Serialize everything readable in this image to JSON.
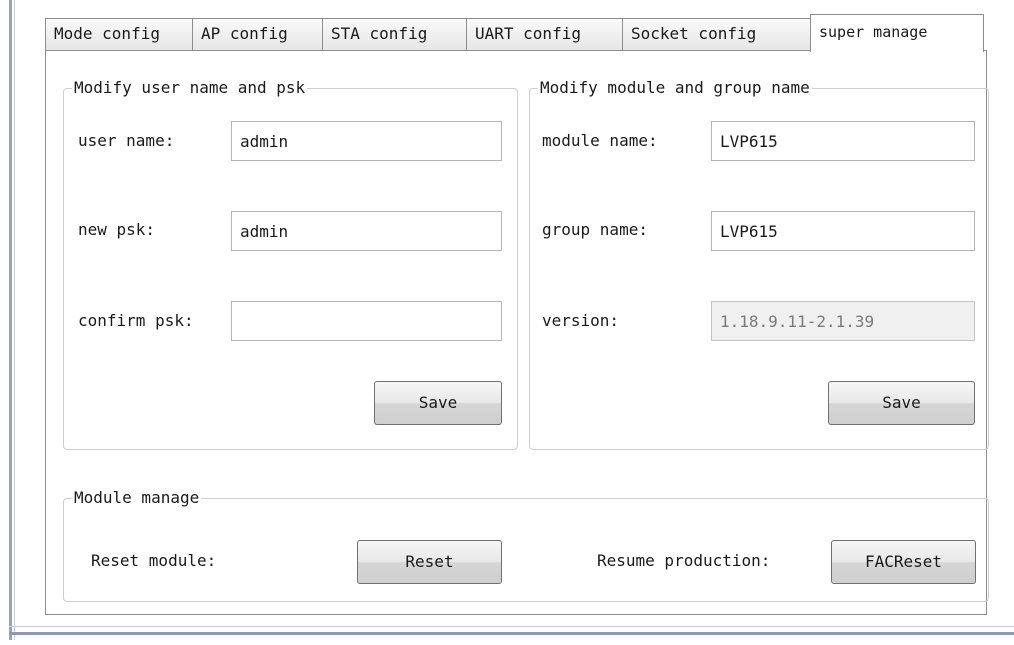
{
  "tabs": [
    {
      "label": "Mode config"
    },
    {
      "label": "AP config"
    },
    {
      "label": "STA config"
    },
    {
      "label": "UART config"
    },
    {
      "label": "Socket config"
    },
    {
      "label": "super manage"
    }
  ],
  "user_group": {
    "title": "Modify user name and psk",
    "user_name_label": "user name:",
    "user_name_value": "admin",
    "new_psk_label": "new psk:",
    "new_psk_value": "admin",
    "confirm_psk_label": "confirm psk:",
    "confirm_psk_value": "",
    "save_label": "Save"
  },
  "module_group": {
    "title": "Modify module and group name",
    "module_name_label": "module name:",
    "module_name_value": "LVP615",
    "group_name_label": "group name:",
    "group_name_value": "LVP615",
    "version_label": "version:",
    "version_value": "1.18.9.11-2.1.39",
    "save_label": "Save"
  },
  "manage_group": {
    "title": "Module manage",
    "reset_label": "Reset module:",
    "reset_button": "Reset",
    "resume_label": "Resume production:",
    "facreset_button": "FACReset"
  }
}
